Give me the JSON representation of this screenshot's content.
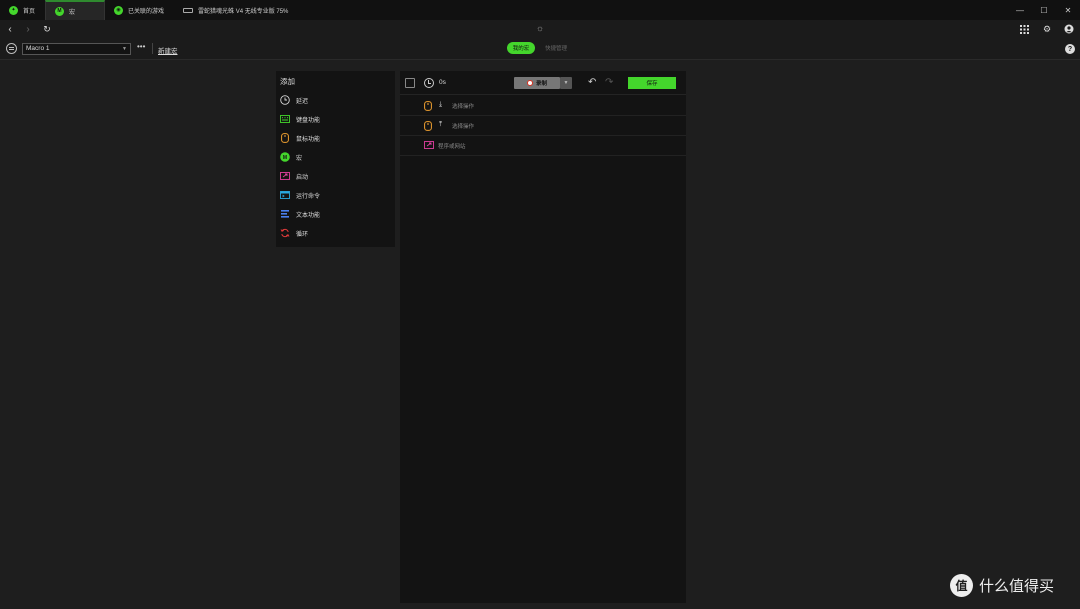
{
  "tabs": [
    {
      "label": "首页",
      "icon": "razer-snake-icon",
      "active": false
    },
    {
      "label": "宏",
      "icon": "macro-m-icon",
      "active": true
    },
    {
      "label": "已关联的游戏",
      "icon": "gamepad-icon",
      "active": false
    },
    {
      "label": "雷蛇猎魂光蛛 V4 无线专业版 75%",
      "icon": "keyboard-icon",
      "active": false
    }
  ],
  "window_controls": {
    "minimize": "—",
    "maximize": "☐",
    "close": "✕"
  },
  "nav": {
    "back": "‹",
    "forward": "›",
    "refresh": "↻",
    "center_icon": "sun-icon",
    "apps": "apps-grid-icon",
    "settings": "gear-icon",
    "account": "user-icon"
  },
  "toolbar": {
    "macro_select_value": "Macro 1",
    "more": "•••",
    "new_macro": "新建宏",
    "tab_my_macros": "我的宏",
    "tab_shortcut_manager": "快捷管理",
    "help": "?"
  },
  "add_panel": {
    "title": "添加",
    "items": [
      {
        "label": "延迟",
        "icon": "clock-icon",
        "color": "#d8d8d8"
      },
      {
        "label": "键盘功能",
        "icon": "keyboard-icon",
        "color": "#44d62c"
      },
      {
        "label": "鼠标功能",
        "icon": "mouse-icon",
        "color": "#f0a030"
      },
      {
        "label": "宏",
        "icon": "macro-icon",
        "color": "#44d62c"
      },
      {
        "label": "启动",
        "icon": "launch-icon",
        "color": "#e040a0"
      },
      {
        "label": "运行命令",
        "icon": "command-icon",
        "color": "#2aa8e0"
      },
      {
        "label": "文本功能",
        "icon": "text-icon",
        "color": "#4a80f0"
      },
      {
        "label": "循环",
        "icon": "loop-icon",
        "color": "#e03a3a"
      }
    ]
  },
  "editor": {
    "duration": "0s",
    "record_label": "录制",
    "save_label": "保存",
    "rows": [
      {
        "icon": "mouse-icon",
        "arrow": "⤓",
        "text": "选择操作"
      },
      {
        "icon": "mouse-icon",
        "arrow": "⤒",
        "text": "选择操作"
      },
      {
        "icon": "launch-icon",
        "arrow": "",
        "text": "程序或网站"
      }
    ]
  },
  "watermark": {
    "logo": "值",
    "text": "什么值得买"
  }
}
